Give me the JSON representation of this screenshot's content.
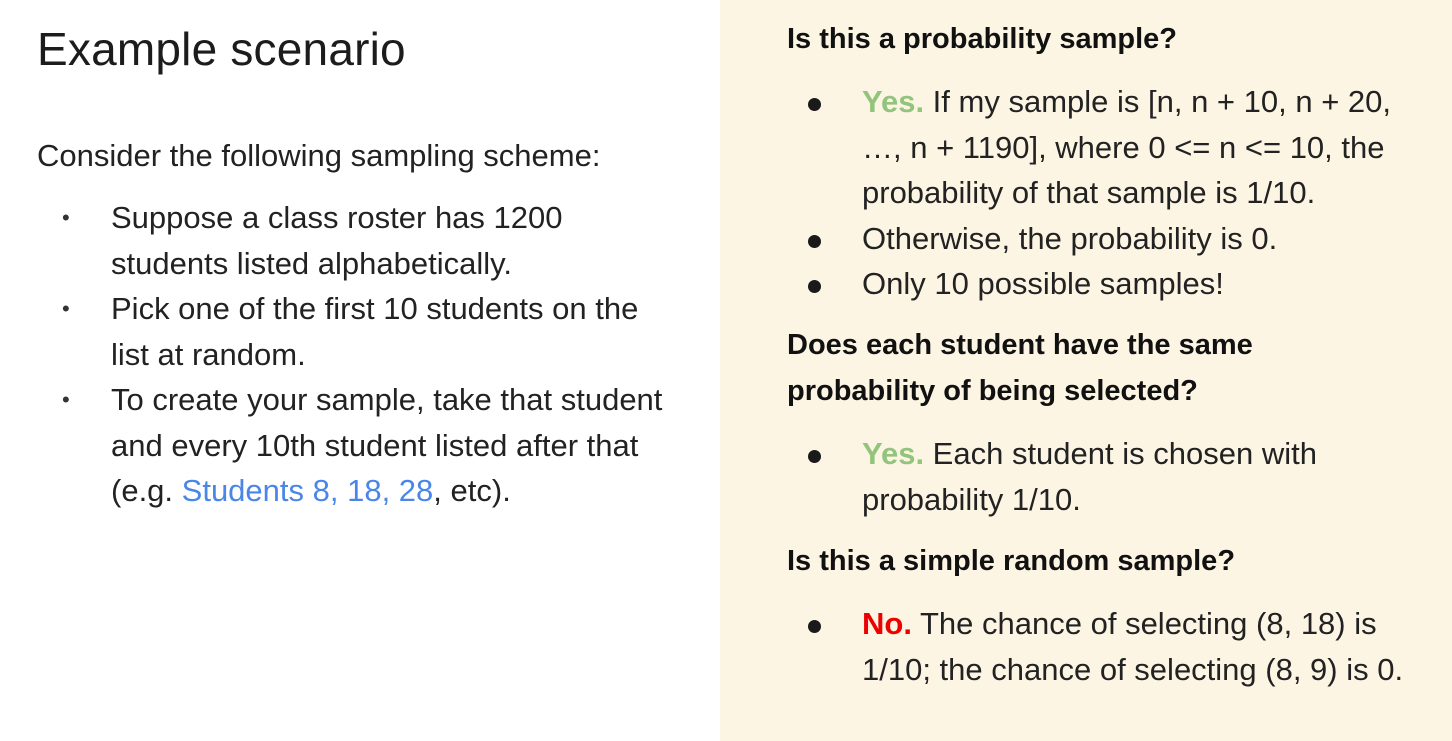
{
  "left": {
    "title": "Example scenario",
    "intro": "Consider the following sampling scheme:",
    "bullets": [
      {
        "text": "Suppose a class roster has 1200 students listed alphabetically."
      },
      {
        "text": "Pick one of the first 10 students on the list at random."
      },
      {
        "text_before": "To create your sample, take that student and every 10th student listed after that (e.g. ",
        "link_text": "Students 8, 18, 28",
        "text_after": ", etc)."
      }
    ]
  },
  "right": {
    "section1": {
      "heading": "Is this a probability sample?",
      "items": [
        {
          "answer": "Yes.",
          "text": " If my sample is [n, n + 10, n + 20, …, n + 1190], where 0 <= n <= 10, the probability of that sample is 1/10."
        },
        {
          "text": "Otherwise, the probability is 0."
        },
        {
          "text": "Only 10 possible samples!"
        }
      ]
    },
    "section2": {
      "heading": "Does each student have the same probability of being selected?",
      "items": [
        {
          "answer": "Yes.",
          "text": " Each student is chosen with probability 1/10."
        }
      ]
    },
    "section3": {
      "heading": "Is this a simple random sample?",
      "items": [
        {
          "answer": "No.",
          "text": " The chance of selecting (8, 18) is 1/10; the chance of selecting (8, 9) is 0."
        }
      ]
    }
  },
  "colors": {
    "link": "#4a86e8",
    "yes": "#93c47d",
    "no": "#ee0000",
    "panel_background": "#fdf5e4"
  }
}
